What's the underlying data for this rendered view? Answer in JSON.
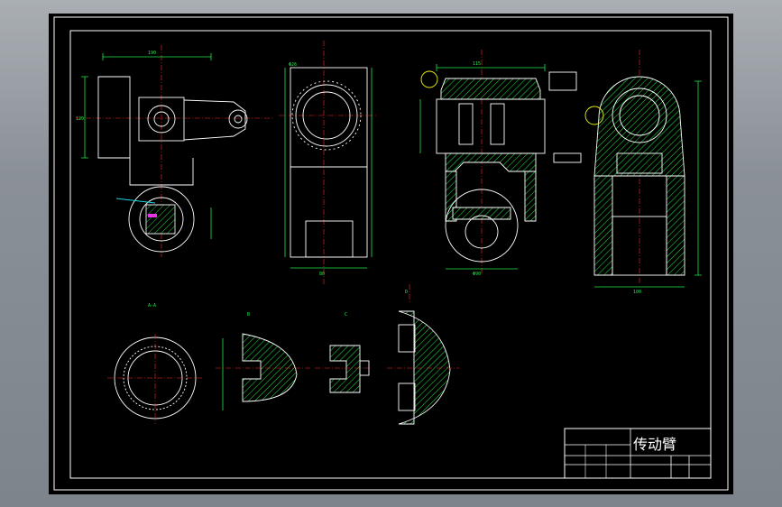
{
  "drawing": {
    "title": "传动臂",
    "background": "#000000",
    "frame_color": "#ffffff",
    "colors": {
      "outline": "#ffffff",
      "dimension": "#22e84a",
      "centerline": "#ff2a2a",
      "hatch": "#22e84a",
      "highlight": "#f2f21b",
      "cyan": "#19d7e6",
      "magenta": "#e635e6"
    }
  }
}
